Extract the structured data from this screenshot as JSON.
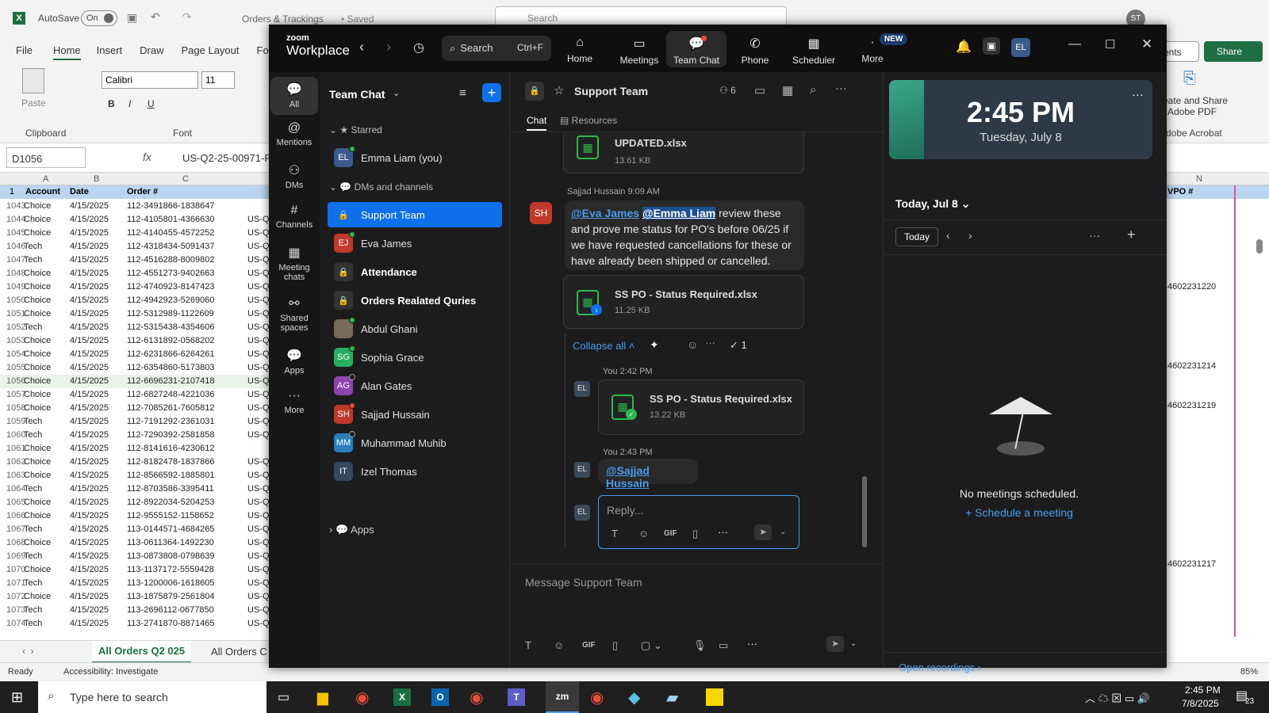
{
  "excel": {
    "autosave_label": "AutoSave",
    "autosave_state": "On",
    "doc_title": "Orders & Trackings",
    "saved": "• Saved",
    "search_placeholder": "Search",
    "user_initials": "ST",
    "menu": [
      "File",
      "Home",
      "Insert",
      "Draw",
      "Page Layout",
      "Fo"
    ],
    "comments": "mments",
    "share": "Share",
    "font_name": "Calibri",
    "font_size": "11",
    "paste": "Paste",
    "clipboard": "Clipboard",
    "font_group": "Font",
    "adobe_line1": "eate and Share",
    "adobe_line2": "Adobe PDF",
    "adobe_group": "dobe Acrobat",
    "name_box": "D1056",
    "formula": "US-Q2-25-00971-F",
    "col_headers": [
      "A",
      "B",
      "C"
    ],
    "col_n": "N",
    "header_row": {
      "num": "1",
      "account": "Account",
      "date": "Date",
      "order": "Order #",
      "po": "VPO #"
    },
    "rows": [
      [
        "1043",
        "Choice",
        "4/15/2025",
        "112-3491866-1838647",
        ""
      ],
      [
        "1044",
        "Choice",
        "4/15/2025",
        "112-4105801-4366630",
        "US-Q"
      ],
      [
        "1045",
        "Choice",
        "4/15/2025",
        "112-4140455-4572252",
        "US-Q"
      ],
      [
        "1046",
        "Tech",
        "4/15/2025",
        "112-4318434-5091437",
        "US-Q"
      ],
      [
        "1047",
        "Tech",
        "4/15/2025",
        "112-4516288-8009802",
        "US-Q"
      ],
      [
        "1048",
        "Choice",
        "4/15/2025",
        "112-4551273-9402663",
        "US-Q"
      ],
      [
        "1049",
        "Choice",
        "4/15/2025",
        "112-4740923-8147423",
        "US-Q"
      ],
      [
        "1050",
        "Choice",
        "4/15/2025",
        "112-4942923-5269060",
        "US-Q"
      ],
      [
        "1051",
        "Choice",
        "4/15/2025",
        "112-5312989-1122609",
        "US-Q"
      ],
      [
        "1052",
        "Tech",
        "4/15/2025",
        "112-5315438-4354606",
        "US-Q"
      ],
      [
        "1053",
        "Choice",
        "4/15/2025",
        "112-6131892-0568202",
        "US-Q"
      ],
      [
        "1054",
        "Choice",
        "4/15/2025",
        "112-6231866-6264261",
        "US-Q"
      ],
      [
        "1055",
        "Choice",
        "4/15/2025",
        "112-6354860-5173803",
        "US-Q"
      ],
      [
        "1056",
        "Choice",
        "4/15/2025",
        "112-6696231-2107418",
        "US-Q"
      ],
      [
        "1057",
        "Choice",
        "4/15/2025",
        "112-6827248-4221036",
        "US-Q"
      ],
      [
        "1058",
        "Choice",
        "4/15/2025",
        "112-7085261-7605812",
        "US-Q"
      ],
      [
        "1059",
        "Tech",
        "4/15/2025",
        "112-7191292-2361031",
        "US-Q"
      ],
      [
        "1060",
        "Tech",
        "4/15/2025",
        "112-7290392-2581858",
        "US-Q"
      ],
      [
        "1061",
        "Choice",
        "4/15/2025",
        "112-8141616-4230612",
        ""
      ],
      [
        "1062",
        "Choice",
        "4/15/2025",
        "112-8182478-1837866",
        "US-Q"
      ],
      [
        "1063",
        "Choice",
        "4/15/2025",
        "112-8566592-1885801",
        "US-Q"
      ],
      [
        "1064",
        "Tech",
        "4/15/2025",
        "112-8703586-3395411",
        "US-Q"
      ],
      [
        "1065",
        "Choice",
        "4/15/2025",
        "112-8922034-5204253",
        "US-Q"
      ],
      [
        "1066",
        "Choice",
        "4/15/2025",
        "112-9555152-1158652",
        "US-Q"
      ],
      [
        "1067",
        "Tech",
        "4/15/2025",
        "113-0144571-4684265",
        "US-Q"
      ],
      [
        "1068",
        "Choice",
        "4/15/2025",
        "113-0611364-1492230",
        "US-Q"
      ],
      [
        "1069",
        "Tech",
        "4/15/2025",
        "113-0873808-0798639",
        "US-Q"
      ],
      [
        "1070",
        "Choice",
        "4/15/2025",
        "113-1137172-5559428",
        "US-Q"
      ],
      [
        "1071",
        "Tech",
        "4/15/2025",
        "113-1200006-1618605",
        "US-Q"
      ],
      [
        "1072",
        "Choice",
        "4/15/2025",
        "113-1875879-2561804",
        "US-Q"
      ],
      [
        "1073",
        "Tech",
        "4/15/2025",
        "113-2696112-0677850",
        "US-Q"
      ],
      [
        "1074",
        "Tech",
        "4/15/2025",
        "113-2741870-8871465",
        "US-Q"
      ]
    ],
    "right_col_values": [
      "4602231220",
      "4602231214",
      "4602231219",
      "4602231217"
    ],
    "sheet_tabs": [
      "All Orders Q2 025",
      "All Orders C"
    ],
    "status_ready": "Ready",
    "accessibility": "Accessibility: Investigate",
    "zoom_pct": "85%"
  },
  "zoom": {
    "brand_top": "zoom",
    "brand_bottom": "Workplace",
    "search_label": "Search",
    "search_shortcut": "Ctrl+F",
    "nav": [
      "Home",
      "Meetings",
      "Team Chat",
      "Phone",
      "Scheduler",
      "More"
    ],
    "new_badge": "NEW",
    "user_initials": "EL",
    "rail": [
      "All",
      "Mentions",
      "DMs",
      "Channels",
      "Meeting chats",
      "Shared spaces",
      "Apps",
      "More"
    ],
    "list_title": "Team Chat",
    "starred": "Starred",
    "dms_channels": "DMs and channels",
    "apps_section": "Apps",
    "contacts": [
      {
        "initials": "EL",
        "name": "Emma Liam (you)",
        "color": "#3a5a8a"
      },
      {
        "initials": "",
        "name": "Support Team",
        "color": ""
      },
      {
        "initials": "EJ",
        "name": "Eva James",
        "color": "#c0392b"
      },
      {
        "initials": "",
        "name": "Attendance",
        "color": ""
      },
      {
        "initials": "",
        "name": "Orders Realated Quries",
        "color": ""
      },
      {
        "initials": "",
        "name": "Abdul Ghani",
        "color": "#7a6a5a"
      },
      {
        "initials": "SG",
        "name": "Sophia Grace",
        "color": "#27ae60"
      },
      {
        "initials": "AG",
        "name": "Alan Gates",
        "color": "#8e44ad"
      },
      {
        "initials": "SH",
        "name": "Sajjad Hussain",
        "color": "#c0392b"
      },
      {
        "initials": "MM",
        "name": "Muhammad Muhib",
        "color": "#2980b9"
      },
      {
        "initials": "IT",
        "name": "Izel Thomas",
        "color": "#34495e"
      }
    ],
    "channel_name": "Support Team",
    "member_count": "6",
    "tab_chat": "Chat",
    "tab_resources": "Resources",
    "top_file_name": "UPDATED.xlsx",
    "top_file_size": "13.61 KB",
    "msg1_author": "Sajjad Hussain",
    "msg1_time": "9:09 AM",
    "msg1_initials": "SH",
    "msg1_mention1": "@Eva James",
    "msg1_mention2": "@Emma Liam",
    "msg1_text": " review these and prove me status for PO's before 06/25 if we have requested cancellations for these or have already been shipped or cancelled.",
    "file1_name": "SS PO - Status Required.xlsx",
    "file1_size": "11.25 KB",
    "collapse_all": "Collapse all",
    "check_count": "1",
    "reply1_head": "You 2:42 PM",
    "reply1_file": "SS PO - Status Required.xlsx",
    "reply1_size": "13.22 KB",
    "reply2_head": "You 2:43 PM",
    "reply2_mention": "@Sajjad Hussain",
    "reply_placeholder": "Reply...",
    "message_placeholder": "Message Support Team",
    "gif": "GIF",
    "cal_time": "2:45 PM",
    "cal_date": "Tuesday, July 8",
    "cal_today_label": "Today, Jul 8",
    "today_btn": "Today",
    "no_meetings": "No meetings scheduled.",
    "schedule_link": "Schedule a meeting",
    "open_recordings": "Open recordings"
  },
  "taskbar": {
    "search_placeholder": "Type here to search",
    "time": "2:45 PM",
    "date": "7/8/2025",
    "notif_count": "23"
  }
}
